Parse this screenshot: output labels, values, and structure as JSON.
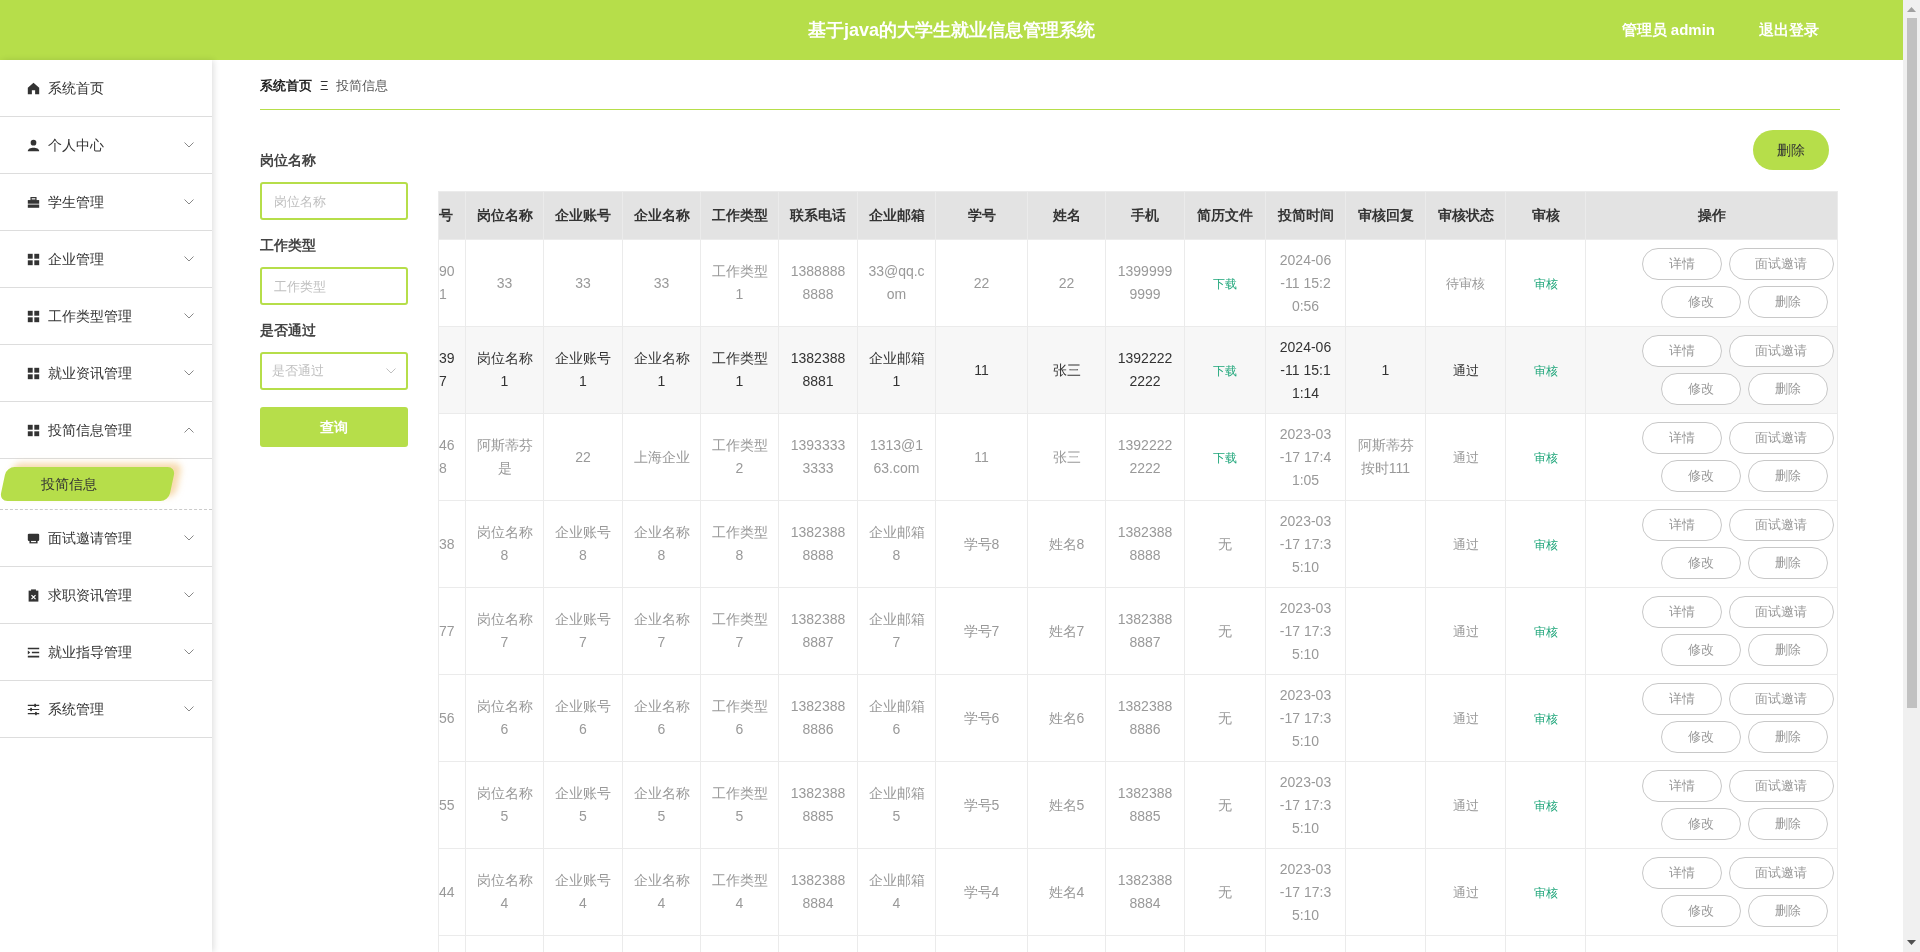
{
  "header": {
    "title": "基于java的大学生就业信息管理系统",
    "user": "管理员 admin",
    "logout": "退出登录"
  },
  "sidebar": {
    "items": [
      {
        "label": "系统首页",
        "kind": "link"
      },
      {
        "label": "个人中心",
        "kind": "menu",
        "expanded": false
      },
      {
        "label": "学生管理",
        "kind": "menu",
        "expanded": false
      },
      {
        "label": "企业管理",
        "kind": "menu",
        "expanded": false
      },
      {
        "label": "工作类型管理",
        "kind": "menu",
        "expanded": false
      },
      {
        "label": "就业资讯管理",
        "kind": "menu",
        "expanded": false
      },
      {
        "label": "投简信息管理",
        "kind": "menu",
        "expanded": true,
        "children": [
          {
            "label": "投简信息",
            "selected": true
          }
        ]
      },
      {
        "label": "面试邀请管理",
        "kind": "menu",
        "expanded": false
      },
      {
        "label": "求职资讯管理",
        "kind": "menu",
        "expanded": false
      },
      {
        "label": "就业指导管理",
        "kind": "menu",
        "expanded": false
      },
      {
        "label": "系统管理",
        "kind": "menu",
        "expanded": false
      }
    ]
  },
  "breadcrumb": [
    "系统首页",
    "投简信息"
  ],
  "breadcrumb_separator": "Ξ",
  "filters": [
    {
      "label": "岗位名称",
      "kind": "text",
      "placeholder": "岗位名称"
    },
    {
      "label": "工作类型",
      "kind": "text",
      "placeholder": "工作类型"
    },
    {
      "label": "是否通过",
      "kind": "select",
      "placeholder": "是否通过"
    }
  ],
  "search_button": "查询",
  "delete_button": "删除",
  "table": {
    "columns": [
      "号",
      "岗位名称",
      "企业账号",
      "企业名称",
      "工作类型",
      "联系电话",
      "企业邮箱",
      "学号",
      "姓名",
      "手机",
      "简历文件",
      "投简时间",
      "审核回复",
      "审核状态",
      "审核",
      "操作"
    ],
    "rows": [
      {
        "hovered": false,
        "cells": [
          "901",
          "33",
          "33",
          "33",
          "工作类型1",
          "13888888888",
          "33@qq.com",
          "22",
          "22",
          "13999999999"
        ],
        "resume": {
          "text": "下载",
          "link": true
        },
        "time": "2024-06-11 15:20:56",
        "status": "待审核",
        "review": "审核",
        "actions": [
          "详情",
          "面试邀请",
          "修改",
          "删除"
        ]
      },
      {
        "hovered": true,
        "cells": [
          "397",
          "岗位名称1",
          "企业账号1",
          "企业名称1",
          "工作类型1",
          "13823888881",
          "企业邮箱1",
          "11",
          "张三",
          "13922222222"
        ],
        "resume": {
          "text": "下载",
          "link": true
        },
        "time": "2024-06-11 15:11:14",
        "reply": "1",
        "status": "通过",
        "review": "审核",
        "actions": [
          "详情",
          "面试邀请",
          "修改",
          "删除"
        ]
      },
      {
        "hovered": false,
        "cells": [
          "468",
          "阿斯蒂芬是",
          "22",
          "上海企业",
          "工作类型2",
          "13933333333",
          "1313@163.com",
          "11",
          "张三",
          "13922222222"
        ],
        "resume": {
          "text": "下载",
          "link": true
        },
        "time": "2023-03-17 17:41:05",
        "reply": "阿斯蒂芬按时111",
        "status": "通过",
        "review": "审核",
        "actions": [
          "详情",
          "面试邀请",
          "修改",
          "删除"
        ]
      },
      {
        "hovered": false,
        "cells": [
          "38",
          "岗位名称8",
          "企业账号8",
          "企业名称8",
          "工作类型8",
          "13823888888",
          "企业邮箱8",
          "学号8",
          "姓名8",
          "13823888888"
        ],
        "resume": {
          "text": "无",
          "link": false
        },
        "time": "2023-03-17 17:35:10",
        "status": "通过",
        "review": "审核",
        "actions": [
          "详情",
          "面试邀请",
          "修改",
          "删除"
        ]
      },
      {
        "hovered": false,
        "cells": [
          "77",
          "岗位名称7",
          "企业账号7",
          "企业名称7",
          "工作类型7",
          "13823888887",
          "企业邮箱7",
          "学号7",
          "姓名7",
          "13823888887"
        ],
        "resume": {
          "text": "无",
          "link": false
        },
        "time": "2023-03-17 17:35:10",
        "status": "通过",
        "review": "审核",
        "actions": [
          "详情",
          "面试邀请",
          "修改",
          "删除"
        ]
      },
      {
        "hovered": false,
        "cells": [
          "56",
          "岗位名称6",
          "企业账号6",
          "企业名称6",
          "工作类型6",
          "13823888886",
          "企业邮箱6",
          "学号6",
          "姓名6",
          "13823888886"
        ],
        "resume": {
          "text": "无",
          "link": false
        },
        "time": "2023-03-17 17:35:10",
        "status": "通过",
        "review": "审核",
        "actions": [
          "详情",
          "面试邀请",
          "修改",
          "删除"
        ]
      },
      {
        "hovered": false,
        "cells": [
          "55",
          "岗位名称5",
          "企业账号5",
          "企业名称5",
          "工作类型5",
          "13823888885",
          "企业邮箱5",
          "学号5",
          "姓名5",
          "13823888885"
        ],
        "resume": {
          "text": "无",
          "link": false
        },
        "time": "2023-03-17 17:35:10",
        "status": "通过",
        "review": "审核",
        "actions": [
          "详情",
          "面试邀请",
          "修改",
          "删除"
        ]
      },
      {
        "hovered": false,
        "cells": [
          "44",
          "岗位名称4",
          "企业账号4",
          "企业名称4",
          "工作类型4",
          "13823888884",
          "企业邮箱4",
          "学号4",
          "姓名4",
          "13823888884"
        ],
        "resume": {
          "text": "无",
          "link": false
        },
        "time": "2023-03-17 17:35:10",
        "status": "通过",
        "review": "审核",
        "actions": [
          "详情",
          "面试邀请",
          "修改",
          "删除"
        ]
      }
    ]
  }
}
